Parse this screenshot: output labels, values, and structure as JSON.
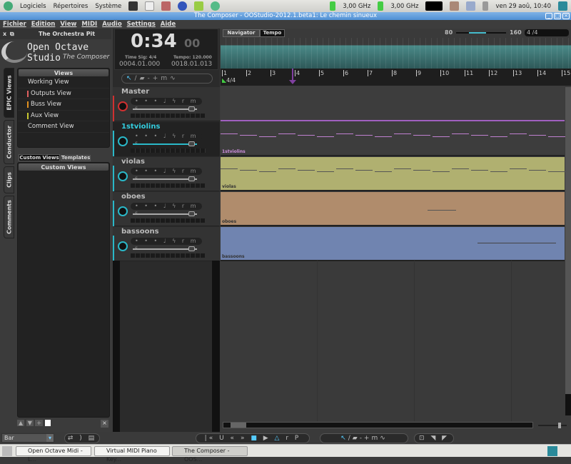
{
  "panel": {
    "menus": [
      "Logiciels",
      "Répertoires",
      "Système"
    ],
    "cpu1": "3,00 GHz",
    "cpu2": "3,00 GHz",
    "clock": "ven 29 aoû, 10:40"
  },
  "window": {
    "title": "The Composer - OOStudio-2012.1.beta1:     Le chemin sinueux"
  },
  "menubar": [
    "Fichier",
    "Edition",
    "View",
    "MIDI",
    "Audio",
    "Settings",
    "Aide"
  ],
  "left": {
    "header": "The Orchestra Pit",
    "logo_title": "Open Octave Studio",
    "logo_sub": "The Composer",
    "vtabs": [
      "EPIC Views",
      "Conductor",
      "Clips",
      "Comments"
    ],
    "views_header": "Views",
    "views": [
      {
        "label": "Working View",
        "color": ""
      },
      {
        "label": "Outputs View",
        "color": "#e06060"
      },
      {
        "label": "Buss View",
        "color": "#e09020"
      },
      {
        "label": "Aux View",
        "color": "#c8c830"
      },
      {
        "label": "Comment View",
        "color": ""
      }
    ],
    "subtabs": [
      "Custom Views",
      "Templates"
    ],
    "custom_header": "Custom Views",
    "snap": "Bar"
  },
  "clock": {
    "time": "0:34",
    "frames": "00",
    "timesig_label": "Time Sig: 4/4",
    "tempo_label": "Tempo: 120.000",
    "pos1": "0004.01.000",
    "pos2": "0018.01.013"
  },
  "tracks": [
    {
      "name": "Master",
      "color": "#d03030"
    },
    {
      "name": "1stviolins",
      "color": "#2ab8c8"
    },
    {
      "name": "violas",
      "color": "#2ab8c8"
    },
    {
      "name": "oboes",
      "color": "#2ab8c8"
    },
    {
      "name": "bassoons",
      "color": "#2ab8c8"
    }
  ],
  "track_buttons": "• • • ♩ ϟ r m s",
  "arrange": {
    "tabs": [
      "Navigator",
      "Tempo"
    ],
    "tempo_min": "80",
    "tempo_max": "160",
    "timesig": "4 /4",
    "ruler_sig": "4/4",
    "bars": [
      "1",
      "2",
      "3",
      "4",
      "5",
      "6",
      "7",
      "8",
      "9",
      "10",
      "11",
      "12",
      "13",
      "14",
      "15"
    ],
    "lanes": [
      {
        "name": "1stviolins",
        "color": "#3d3d3d",
        "line": "#c080d0"
      },
      {
        "name": "violas",
        "color": "#b0b070",
        "line": "#555"
      },
      {
        "name": "oboes",
        "color": "#b08c6c",
        "line": "#555"
      },
      {
        "name": "bassoons",
        "color": "#7084b0",
        "line": "#444"
      }
    ]
  },
  "taskbar": [
    "Open Octave Midi - L...",
    "Virtual MIDI Piano Key...",
    "The Composer - OOS..."
  ]
}
